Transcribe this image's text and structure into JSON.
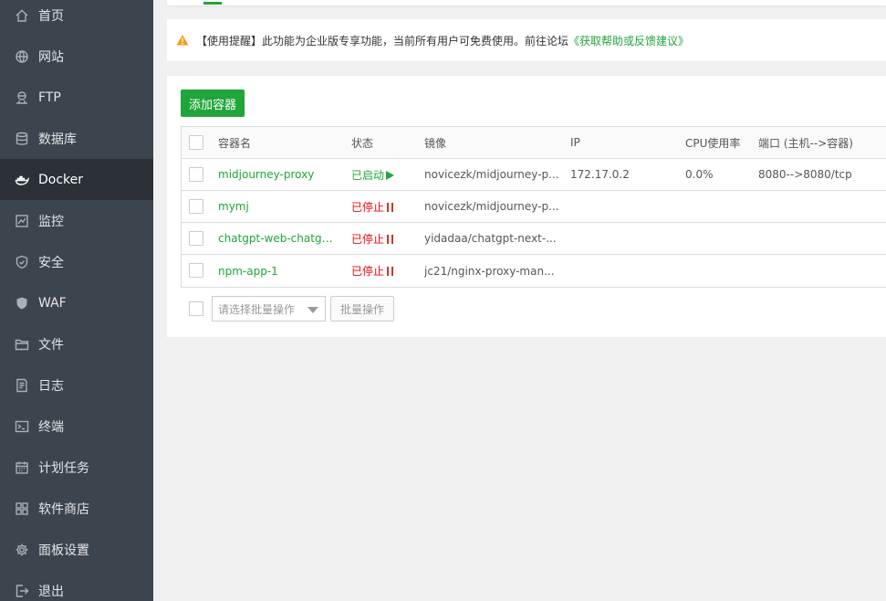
{
  "sidebar": {
    "items": [
      {
        "label": "首页",
        "icon": "home-icon"
      },
      {
        "label": "网站",
        "icon": "globe-icon"
      },
      {
        "label": "FTP",
        "icon": "ftp-icon"
      },
      {
        "label": "数据库",
        "icon": "database-icon"
      },
      {
        "label": "Docker",
        "icon": "docker-icon",
        "active": true
      },
      {
        "label": "监控",
        "icon": "monitor-icon"
      },
      {
        "label": "安全",
        "icon": "shield-icon"
      },
      {
        "label": "WAF",
        "icon": "waf-shield-icon"
      },
      {
        "label": "文件",
        "icon": "folder-icon"
      },
      {
        "label": "日志",
        "icon": "log-icon"
      },
      {
        "label": "终端",
        "icon": "terminal-icon"
      },
      {
        "label": "计划任务",
        "icon": "calendar-icon"
      },
      {
        "label": "软件商店",
        "icon": "apps-icon"
      },
      {
        "label": "面板设置",
        "icon": "gear-icon"
      },
      {
        "label": "退出",
        "icon": "logout-icon"
      }
    ]
  },
  "alert": {
    "text": "【使用提醒】此功能为企业版专享功能，当前所有用户可免费使用。前往论坛",
    "link": "《获取帮助或反馈建议》"
  },
  "toolbar": {
    "add_label": "添加容器"
  },
  "table": {
    "headers": {
      "name": "容器名",
      "status": "状态",
      "image": "镜像",
      "ip": "IP",
      "cpu": "CPU使用率",
      "port": "端口 (主机-->容器)"
    },
    "rows": [
      {
        "name": "midjourney-proxy",
        "status": "已启动",
        "state": "running",
        "image": "novicezk/midjourney-p...",
        "ip": "172.17.0.2",
        "cpu": "0.0%",
        "port": "8080-->8080/tcp"
      },
      {
        "name": "mymj",
        "status": "已停止",
        "state": "stopped",
        "image": "novicezk/midjourney-p...",
        "ip": "",
        "cpu": "",
        "port": ""
      },
      {
        "name": "chatgpt-web-chatgp...",
        "status": "已停止",
        "state": "stopped",
        "image": "yidadaa/chatgpt-next-...",
        "ip": "",
        "cpu": "",
        "port": ""
      },
      {
        "name": "npm-app-1",
        "status": "已停止",
        "state": "stopped",
        "image": "jc21/nginx-proxy-man...",
        "ip": "",
        "cpu": "",
        "port": ""
      }
    ]
  },
  "batch": {
    "select_placeholder": "请选择批量操作",
    "button_label": "批量操作"
  },
  "colors": {
    "accent": "#20a53a",
    "sidebar_bg": "#3c444d",
    "sidebar_active": "#2c3138",
    "stopped": "#ef0808"
  }
}
